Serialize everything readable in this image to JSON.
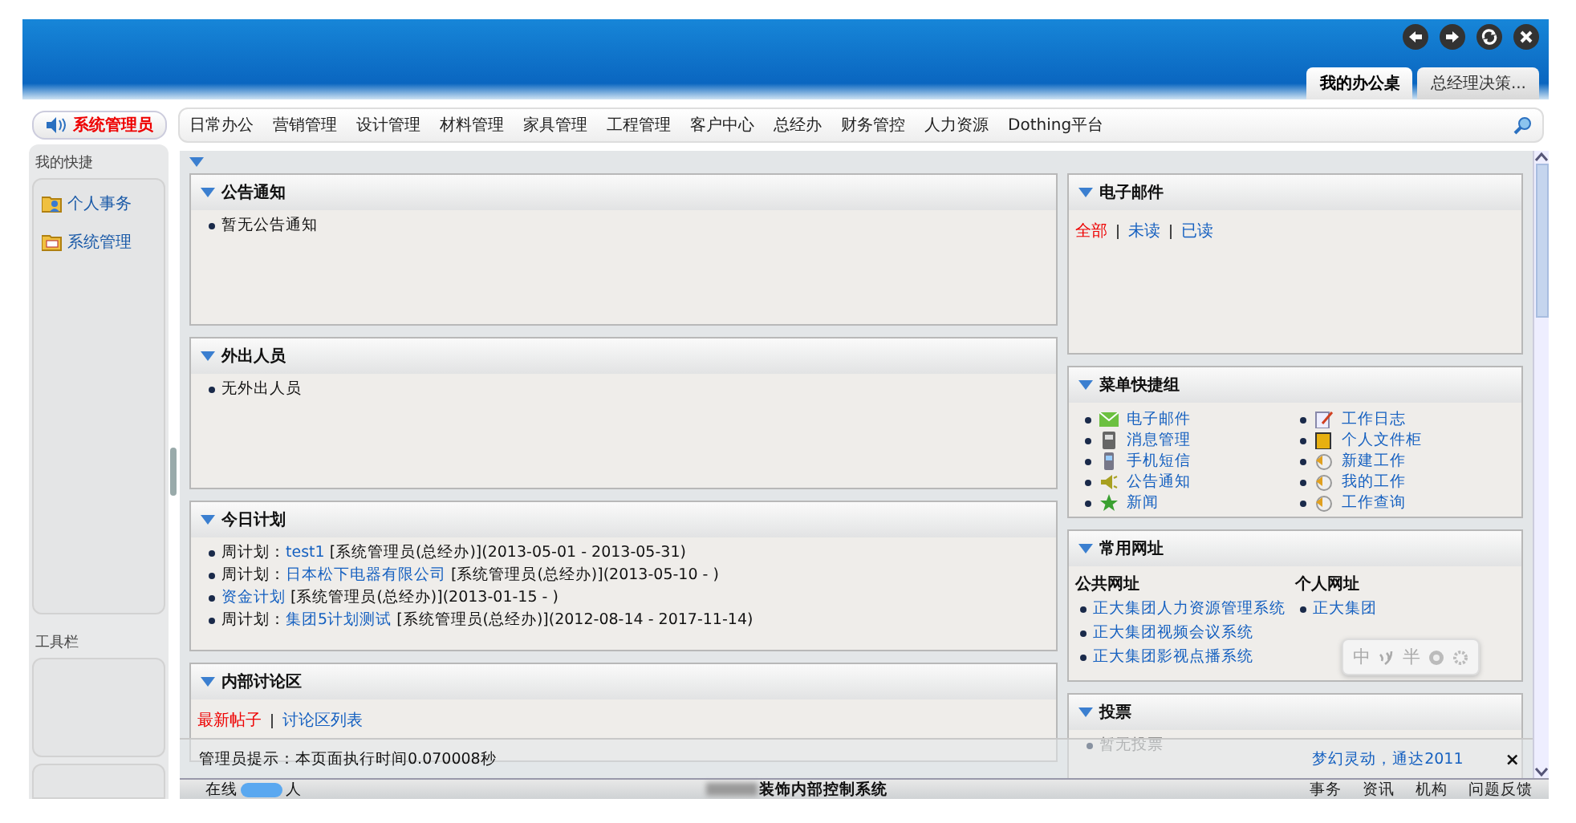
{
  "header_tabs": [
    {
      "label": "我的办公桌",
      "selected": true
    },
    {
      "label": "总经理决策...",
      "selected": false
    }
  ],
  "user_badge": "系统管理员",
  "menu": [
    {
      "label": "日常办公"
    },
    {
      "label": "营销管理"
    },
    {
      "label": "设计管理"
    },
    {
      "label": "材料管理"
    },
    {
      "label": "家具管理"
    },
    {
      "label": "工程管理"
    },
    {
      "label": "客户中心"
    },
    {
      "label": "总经办"
    },
    {
      "label": "财务管控"
    },
    {
      "label": "人力资源"
    },
    {
      "label": "Dothing平台"
    }
  ],
  "sidebar": {
    "shortcuts_title": "我的快捷",
    "shortcuts": [
      {
        "label": "个人事务"
      },
      {
        "label": "系统管理"
      }
    ],
    "toolbar_title": "工具栏"
  },
  "left_panels": [
    {
      "kind": "list",
      "title": "公告通知",
      "items": [
        "暂无公告通知"
      ]
    },
    {
      "kind": "list",
      "title": "外出人员",
      "items": [
        "无外出人员"
      ]
    },
    {
      "kind": "plans",
      "title": "今日计划",
      "items": [
        {
          "prefix": "周计划：",
          "link": "test1",
          "detail": "[系统管理员(总经办)](2013-05-01 - 2013-05-31)"
        },
        {
          "prefix": "周计划：",
          "link": "日本松下电器有限公司",
          "detail": "[系统管理员(总经办)](2013-05-10 - )"
        },
        {
          "link": "资金计划",
          "detail": "[系统管理员(总经办)](2013-01-15 - )"
        },
        {
          "prefix": "周计划：",
          "link": "集团5计划测试",
          "detail": "[系统管理员(总经办)](2012-08-14 - 2017-11-14)"
        }
      ]
    },
    {
      "kind": "filters",
      "title": "内部讨论区",
      "filters": [
        {
          "label": "最新帖子",
          "selected": true
        },
        {
          "label": "讨论区列表",
          "selected": false
        }
      ]
    }
  ],
  "right_panels": [
    {
      "kind": "filters",
      "title": "电子邮件",
      "filters": [
        {
          "label": "全部",
          "selected": true
        },
        {
          "label": "未读",
          "selected": false
        },
        {
          "label": "已读",
          "selected": false
        }
      ]
    },
    {
      "kind": "grid",
      "title": "菜单快捷组",
      "items": [
        {
          "label": "电子邮件"
        },
        {
          "label": "消息管理"
        },
        {
          "label": "手机短信"
        },
        {
          "label": "公告通知"
        },
        {
          "label": "新闻"
        },
        {
          "label": "工作日志"
        },
        {
          "label": "个人文件柜"
        },
        {
          "label": "新建工作"
        },
        {
          "label": "我的工作"
        },
        {
          "label": "工作查询"
        }
      ]
    },
    {
      "kind": "urls",
      "title": "常用网址",
      "groups": [
        {
          "title": "公共网址",
          "items": [
            "正大集团人力资源管理系统",
            "正大集团视频会议系统",
            "正大集团影视点播系统"
          ]
        },
        {
          "title": "个人网址",
          "items": [
            "正大集团"
          ]
        }
      ]
    },
    {
      "kind": "list",
      "title": "投票",
      "items": [
        "暂无投票"
      ]
    }
  ],
  "ime_toolbar": {
    "mode": "中",
    "width": "半"
  },
  "admin_tip": "管理员提示：本页面执行时间0.070008秒",
  "notice": {
    "link": "梦幻灵动，通达2011",
    "close": "×"
  },
  "status_bar": {
    "online_label": "在线",
    "online_unit": "人",
    "system_title": "装饰内部控制系统",
    "links": [
      "事务",
      "资讯",
      "机构",
      "问题反馈"
    ]
  }
}
